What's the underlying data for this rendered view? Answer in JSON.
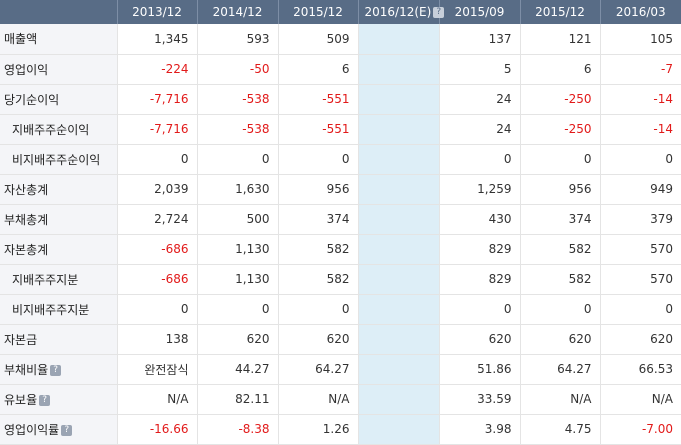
{
  "columns": [
    "2013/12",
    "2014/12",
    "2015/12",
    "2016/12(E)",
    "2015/09",
    "2015/12",
    "2016/03"
  ],
  "estimate_column_index": 3,
  "colors": {
    "header_bg": "#586c86",
    "label_bg": "#f4f5f8",
    "estimate_bg": "#ddeef7",
    "negative": "#e21a1a"
  },
  "rows": [
    {
      "label": "매출액",
      "indent": false,
      "help": false,
      "values": [
        "1,345",
        "593",
        "509",
        "",
        "137",
        "121",
        "105"
      ]
    },
    {
      "label": "영업이익",
      "indent": false,
      "help": false,
      "values": [
        "-224",
        "-50",
        "6",
        "",
        "5",
        "6",
        "-7"
      ]
    },
    {
      "label": "당기순이익",
      "indent": false,
      "help": false,
      "values": [
        "-7,716",
        "-538",
        "-551",
        "",
        "24",
        "-250",
        "-14"
      ]
    },
    {
      "label": "지배주주순이익",
      "indent": true,
      "help": false,
      "values": [
        "-7,716",
        "-538",
        "-551",
        "",
        "24",
        "-250",
        "-14"
      ]
    },
    {
      "label": "비지배주주순이익",
      "indent": true,
      "help": false,
      "values": [
        "0",
        "0",
        "0",
        "",
        "0",
        "0",
        "0"
      ]
    },
    {
      "label": "자산총계",
      "indent": false,
      "help": false,
      "values": [
        "2,039",
        "1,630",
        "956",
        "",
        "1,259",
        "956",
        "949"
      ]
    },
    {
      "label": "부채총계",
      "indent": false,
      "help": false,
      "values": [
        "2,724",
        "500",
        "374",
        "",
        "430",
        "374",
        "379"
      ]
    },
    {
      "label": "자본총계",
      "indent": false,
      "help": false,
      "values": [
        "-686",
        "1,130",
        "582",
        "",
        "829",
        "582",
        "570"
      ]
    },
    {
      "label": "지배주주지분",
      "indent": true,
      "help": false,
      "values": [
        "-686",
        "1,130",
        "582",
        "",
        "829",
        "582",
        "570"
      ]
    },
    {
      "label": "비지배주주지분",
      "indent": true,
      "help": false,
      "values": [
        "0",
        "0",
        "0",
        "",
        "0",
        "0",
        "0"
      ]
    },
    {
      "label": "자본금",
      "indent": false,
      "help": false,
      "values": [
        "138",
        "620",
        "620",
        "",
        "620",
        "620",
        "620"
      ]
    },
    {
      "label": "부채비율",
      "indent": false,
      "help": true,
      "values": [
        "완전잠식",
        "44.27",
        "64.27",
        "",
        "51.86",
        "64.27",
        "66.53"
      ]
    },
    {
      "label": "유보율",
      "indent": false,
      "help": true,
      "values": [
        "N/A",
        "82.11",
        "N/A",
        "",
        "33.59",
        "N/A",
        "N/A"
      ]
    },
    {
      "label": "영업이익률",
      "indent": false,
      "help": true,
      "values": [
        "-16.66",
        "-8.38",
        "1.26",
        "",
        "3.98",
        "4.75",
        "-7.00"
      ]
    }
  ]
}
